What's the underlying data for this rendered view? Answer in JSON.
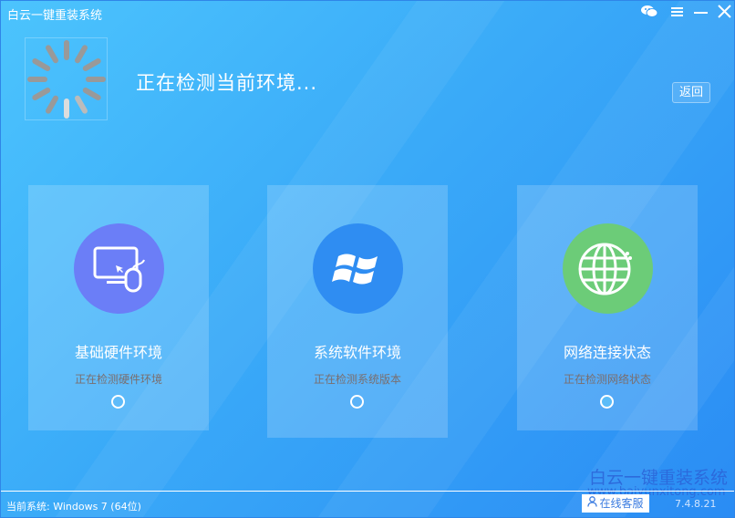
{
  "window": {
    "title": "白云一键重装系统",
    "icons": [
      "wechat-icon",
      "menu-icon",
      "minimize-icon",
      "close-icon"
    ]
  },
  "header": {
    "status": "正在检测当前环境...",
    "back_label": "返回"
  },
  "cards": [
    {
      "title": "基础硬件环境",
      "status": "正在检测硬件环境",
      "color": "#6b7ef7",
      "icon": "computer-mouse-icon"
    },
    {
      "title": "系统软件环境",
      "status": "正在检测系统版本",
      "color": "#2f8df2",
      "icon": "windows-icon"
    },
    {
      "title": "网络连接状态",
      "status": "正在检测网络状态",
      "color": "#6ccc78",
      "icon": "globe-icon"
    }
  ],
  "footer": {
    "current_system": "当前系统: Windows 7 (64位)",
    "service_label": "在线客服",
    "version": "7.4.8.21"
  },
  "watermark": {
    "name": "白云一键重装系统",
    "url": "www.baiyunxitong.com"
  }
}
